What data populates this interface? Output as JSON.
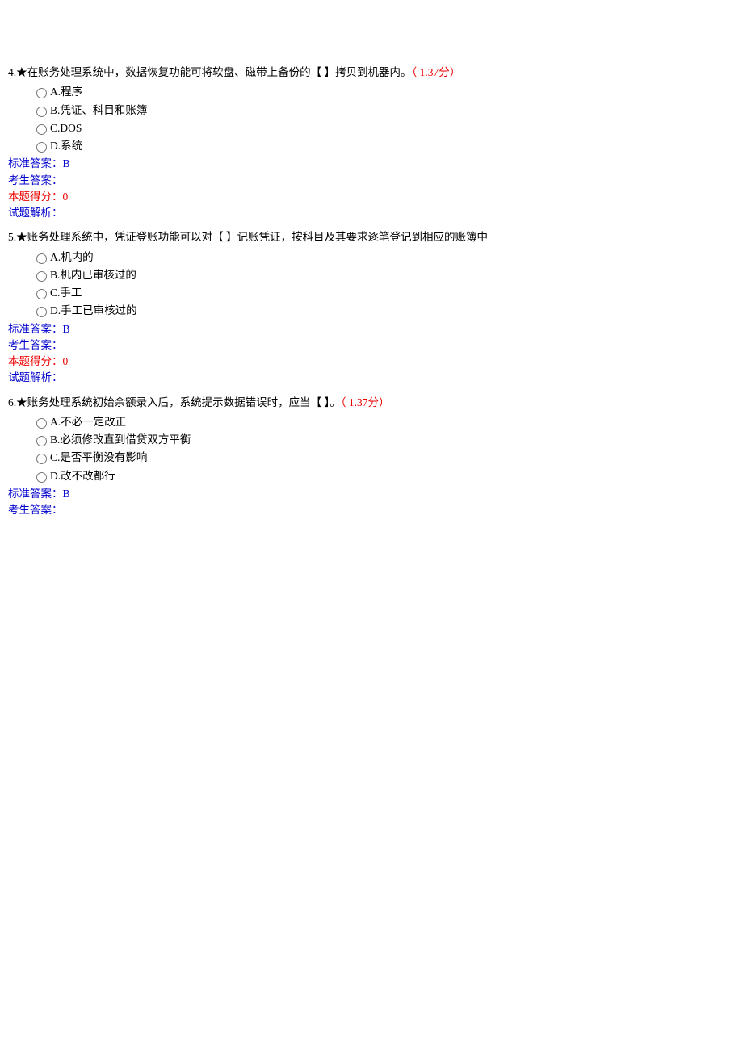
{
  "q4": {
    "num": "4.",
    "star": "★",
    "stem": "在账务处理系统中，数据恢复功能可将软盘、磁带上备份的【  】拷贝到机器内。",
    "points": "（ 1.37分）",
    "options": {
      "a": "A.程序",
      "b": "B.凭证、科目和账簿",
      "c": "C.DOS",
      "d": "D.系统"
    },
    "standard_label": "标准答案：",
    "standard_value": "B",
    "user_label": "考生答案：",
    "score_label": "本题得分：",
    "score_value": "0",
    "analysis_label": "试题解析："
  },
  "q5": {
    "num": "5.",
    "star": "★",
    "stem": "账务处理系统中，凭证登账功能可以对【  】记账凭证，按科目及其要求逐笔登记到相应的账簿中",
    "options": {
      "a": "A.机内的",
      "b": "B.机内已审核过的",
      "c": "C.手工",
      "d": "D.手工已审核过的"
    },
    "standard_label": "标准答案：",
    "standard_value": "B",
    "user_label": "考生答案：",
    "score_label": "本题得分：",
    "score_value": "0",
    "analysis_label": "试题解析："
  },
  "q6": {
    "num": "6.",
    "star": "★",
    "stem": "账务处理系统初始余额录入后，系统提示数据错误时，应当【  】。",
    "points": "（ 1.37分）",
    "options": {
      "a": "A.不必一定改正",
      "b": "B.必须修改直到借贷双方平衡",
      "c": "C.是否平衡没有影响",
      "d": "D.改不改都行"
    },
    "standard_label": "标准答案：",
    "standard_value": "B",
    "user_label": "考生答案："
  }
}
